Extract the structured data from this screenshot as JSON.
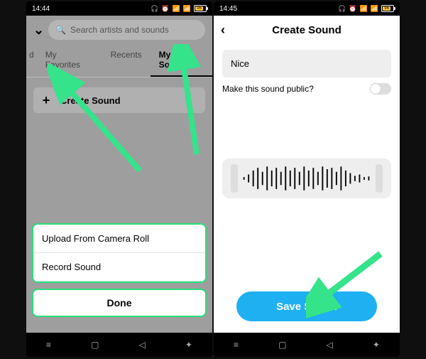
{
  "status": {
    "time_left": "14:44",
    "time_right": "14:45",
    "battery_pct": "96"
  },
  "left": {
    "search_placeholder": "Search artists and sounds",
    "tabs": {
      "cut": "d",
      "favorites": "My Favorites",
      "recents": "Recents",
      "mysounds": "My Sounds"
    },
    "create_label": "Create Sound",
    "sheet": {
      "upload": "Upload From Camera Roll",
      "record": "Record Sound",
      "done": "Done"
    }
  },
  "right": {
    "title": "Create Sound",
    "sound_name": "Nice",
    "public_label": "Make this sound public?",
    "save_label": "Save Sound"
  },
  "colors": {
    "arrow": "#35e38a",
    "primary": "#1fb0f2"
  }
}
